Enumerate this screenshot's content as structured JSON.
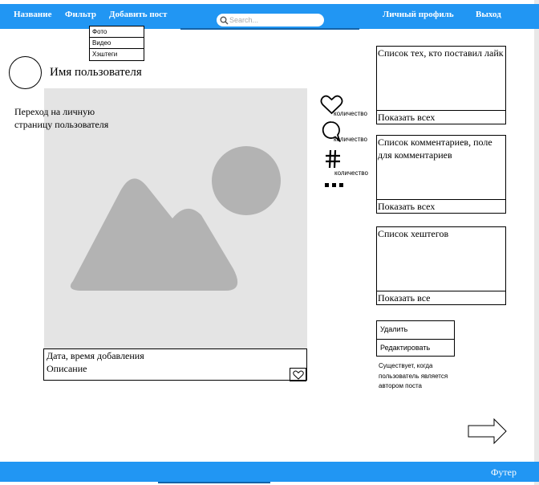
{
  "nav": {
    "title": "Название",
    "filter": "Фильтр",
    "add_post": "Добавить пост",
    "profile": "Личный профиль",
    "logout": "Выход"
  },
  "search": {
    "placeholder": "Search..."
  },
  "filter_menu": {
    "items": [
      "Фото",
      "Видео",
      "Хэштеги"
    ]
  },
  "user": {
    "name": "Имя пользователя",
    "profile_link": "Переход на личную страницу пользователя"
  },
  "post": {
    "date_label": "Дата, время добавления",
    "description": "Описание"
  },
  "actions": {
    "like_count": "количество",
    "comment_count": "количество",
    "hashtag_count": "количество"
  },
  "panels": {
    "likes": {
      "title": "Список тех, кто поставил лайк",
      "button": "Показать всех"
    },
    "comments": {
      "title": "Список комментариев, поле для комментариев",
      "button": "Показать всех"
    },
    "hashtags": {
      "title": "Список хештегов",
      "button": "Показать все"
    }
  },
  "owner_actions": {
    "delete": "Удалить",
    "edit": "Редактировать",
    "note": "Существует, когда пользователь является автором поста"
  },
  "footer": {
    "text": "Футер"
  },
  "colors": {
    "bar": "#2196f3",
    "image_bg": "#e4e4e4",
    "image_shapes": "#b3b3b3"
  },
  "icons": [
    "search-icon",
    "heart-icon",
    "comment-icon",
    "hashtag-icon",
    "more-icon",
    "arrow-right-icon",
    "image-placeholder-icon"
  ]
}
